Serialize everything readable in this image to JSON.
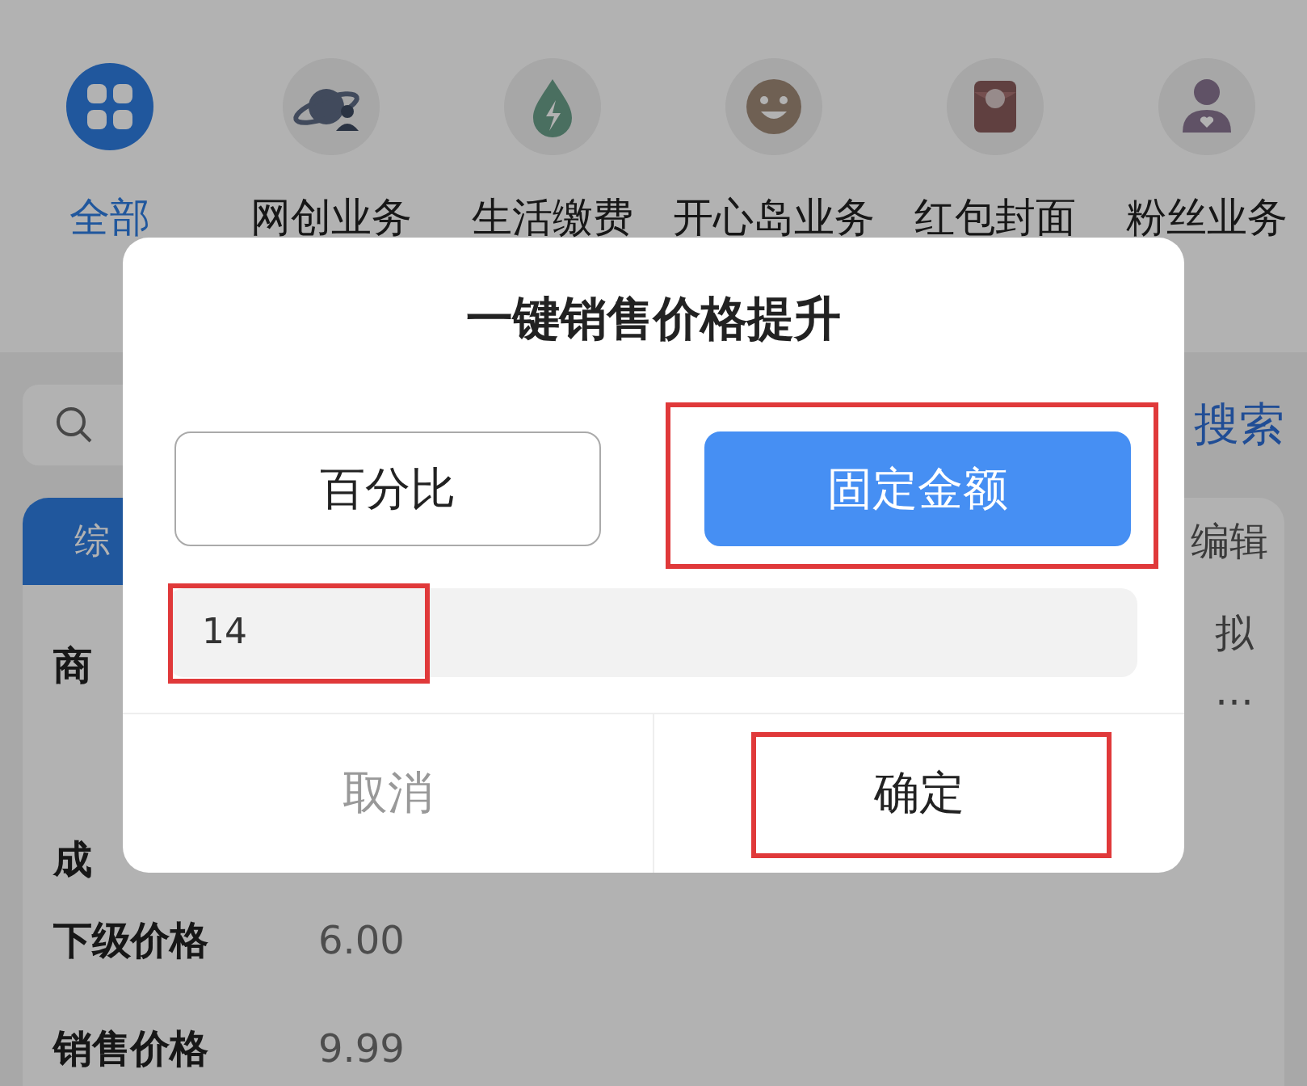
{
  "categories": [
    {
      "label": "全部",
      "selected": true
    },
    {
      "label": "网创业务",
      "selected": false
    },
    {
      "label": "生活缴费",
      "selected": false
    },
    {
      "label": "开心岛业务",
      "selected": false
    },
    {
      "label": "红包封面",
      "selected": false
    },
    {
      "label": "粉丝业务",
      "selected": false
    }
  ],
  "search": {
    "button": "搜索"
  },
  "card": {
    "tab": "综",
    "edit": "编辑",
    "aside": [
      "拟",
      "…"
    ],
    "rows": [
      {
        "label": "商"
      },
      {
        "label": "成"
      },
      {
        "label": "下级价格",
        "value": "6.00"
      },
      {
        "label": "销售价格",
        "value": "9.99"
      }
    ]
  },
  "dialog": {
    "title": "一键销售价格提升",
    "modes": [
      {
        "label": "百分比",
        "selected": false,
        "highlighted": false
      },
      {
        "label": "固定金额",
        "selected": true,
        "highlighted": true
      }
    ],
    "input": {
      "value": "14",
      "highlighted": true
    },
    "actions": [
      {
        "label": "取消",
        "kind": "cancel",
        "highlighted": false
      },
      {
        "label": "确定",
        "kind": "confirm",
        "highlighted": true
      }
    ]
  }
}
